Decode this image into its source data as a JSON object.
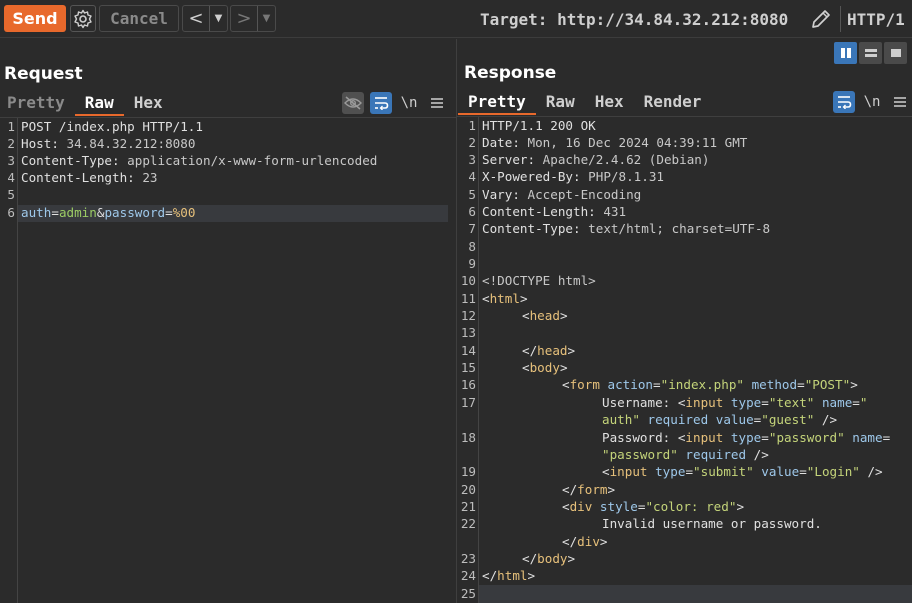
{
  "toolbar": {
    "send_label": "Send",
    "cancel_label": "Cancel",
    "back_label": "<",
    "forward_label": ">",
    "dropdown_glyph": "▼",
    "target_label": "Target: http://34.84.32.212:8080",
    "protocol_label": "HTTP/1",
    "icons": [
      "settings-gear-icon",
      "edit-pencil-icon"
    ],
    "accent_color": "#e8692c"
  },
  "request": {
    "title": "Request",
    "tabs": [
      "Pretty",
      "Raw",
      "Hex"
    ],
    "active_tab": "Raw",
    "newline_toggle": "\\n",
    "line_numbers": [
      "1",
      "2",
      "3",
      "4",
      "5",
      "6"
    ],
    "lines": {
      "l1": "POST /index.php HTTP/1.1",
      "l2_key": "Host:",
      "l2_val": " 34.84.32.212:8080",
      "l3_key": "Content-Type:",
      "l3_val": " application/x-www-form-urlencoded",
      "l4_key": "Content-Length:",
      "l4_val": " 23",
      "l6_p1k": "auth",
      "l6_eq1": "=",
      "l6_p1v": "admin",
      "l6_amp": "&",
      "l6_p2k": "password",
      "l6_eq2": "=",
      "l6_p2v": "%00"
    }
  },
  "response": {
    "title": "Response",
    "tabs": [
      "Pretty",
      "Raw",
      "Hex",
      "Render"
    ],
    "active_tab": "Pretty",
    "newline_toggle": "\\n",
    "line_numbers": [
      "1",
      "2",
      "3",
      "4",
      "5",
      "6",
      "7",
      "8",
      "9",
      "10",
      "11",
      "12",
      "13",
      "14",
      "15",
      "16",
      "17",
      "18",
      "19",
      "20",
      "21",
      "22",
      "23",
      "24",
      "25"
    ],
    "lines": {
      "l1": "HTTP/1.1 200 OK",
      "l2_key": "Date:",
      "l2_val": " Mon, 16 Dec 2024 04:39:11 GMT",
      "l3_key": "Server:",
      "l3_val": " Apache/2.4.62 (Debian)",
      "l4_key": "X-Powered-By:",
      "l4_val": " PHP/8.1.31",
      "l5_key": "Vary:",
      "l5_val": " Accept-Encoding",
      "l6_key": "Content-Length:",
      "l6_val": " 431",
      "l7_key": "Content-Type:",
      "l7_val": " text/html; charset=UTF-8",
      "l10": "<!DOCTYPE html>",
      "l11_open": "<",
      "l11_tag": "html",
      "l11_close": ">",
      "l12_open": "<",
      "l12_tag": "head",
      "l12_close": ">",
      "l14_open": "</",
      "l14_tag": "head",
      "l14_close": ">",
      "l15_open": "<",
      "l15_tag": "body",
      "l15_close": ">",
      "l16_open": "<",
      "l16_tag": "form",
      "l16_a1": " action",
      "l16_eq1": "=",
      "l16_v1": "\"index.php\"",
      "l16_a2": " method",
      "l16_eq2": "=",
      "l16_v2": "\"POST\"",
      "l16_close": ">",
      "l17a_text": "Username: ",
      "l17a_open": "<",
      "l17a_tag": "input",
      "l17a_a1": " type",
      "l17a_eq1": "=",
      "l17a_v1": "\"text\"",
      "l17a_a2": " name",
      "l17a_eq2": "=",
      "l17a_v2": "\"",
      "l17b_v2": "auth\"",
      "l17b_a3": " required",
      "l17b_a4": " value",
      "l17b_eq": "=",
      "l17b_v4": "\"guest\"",
      "l17b_close": " />",
      "l18a_text": "Password: ",
      "l18a_open": "<",
      "l18a_tag": "input",
      "l18a_a1": " type",
      "l18a_eq1": "=",
      "l18a_v1": "\"password\"",
      "l18a_a2": " name",
      "l18a_eq2": "=",
      "l18b_v2": "\"password\"",
      "l18b_a3": " required",
      "l18b_close": " />",
      "l19_open": "<",
      "l19_tag": "input",
      "l19_a1": " type",
      "l19_eq1": "=",
      "l19_v1": "\"submit\"",
      "l19_a2": " value",
      "l19_eq2": "=",
      "l19_v2": "\"Login\"",
      "l19_close": " />",
      "l20_open": "</",
      "l20_tag": "form",
      "l20_close": ">",
      "l21_open": "<",
      "l21_tag": "div",
      "l21_a1": " style",
      "l21_eq1": "=",
      "l21_v1": "\"color: red\"",
      "l21_close": ">",
      "l22_text": "Invalid username or password.",
      "l22b_open": "</",
      "l22b_tag": "div",
      "l22b_close": ">",
      "l23_open": "</",
      "l23_tag": "body",
      "l23_close": ">",
      "l24_open": "</",
      "l24_tag": "html",
      "l24_close": ">"
    }
  }
}
